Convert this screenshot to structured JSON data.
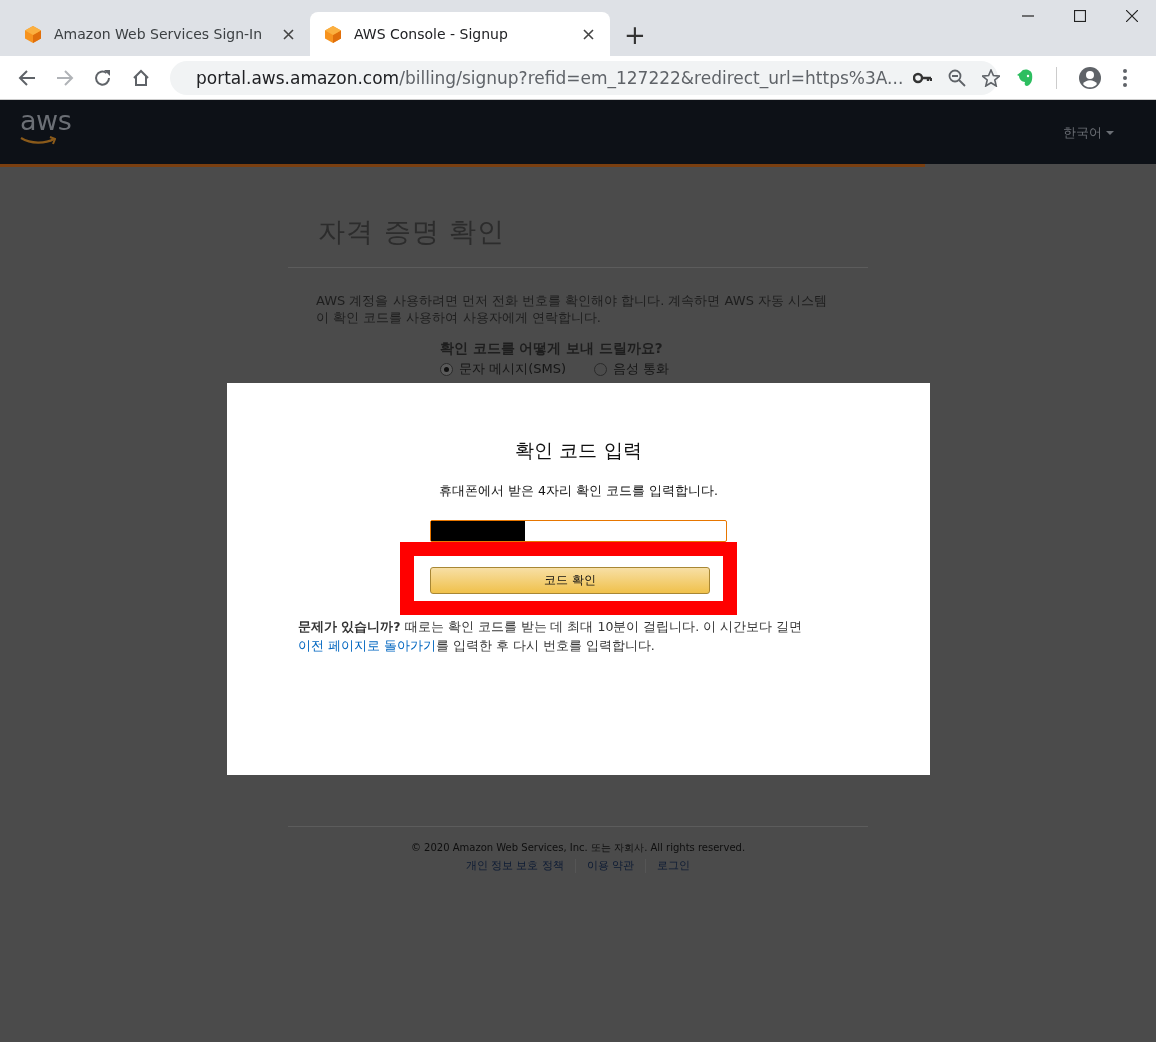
{
  "browser": {
    "tabs": [
      {
        "title": "Amazon Web Services Sign-In",
        "selected": false
      },
      {
        "title": "AWS Console - Signup",
        "selected": true
      }
    ],
    "new_tab": "+",
    "address": {
      "host": "portal.aws.amazon.com",
      "path": "/billing/signup?refid=em_127222&redirect_url=https%3A..."
    }
  },
  "header": {
    "logo": "aws",
    "language": "한국어"
  },
  "page": {
    "title": "자격 증명 확인",
    "intro": "AWS 계정을 사용하려면 먼저 전화 번호를 확인해야 합니다. 계속하면 AWS 자동 시스템이 확인 코드를 사용하여 사용자에게 연락합니다.",
    "question": "확인 코드를 어떻게 보내 드릴까요?",
    "options": [
      {
        "label": "문자 메시지(SMS)",
        "selected": true
      },
      {
        "label": "음성 통화",
        "selected": false
      }
    ],
    "footer": {
      "copyright": "© 2020 Amazon Web Services, Inc. 또는 자회사. All rights reserved.",
      "links": [
        "개인 정보 보호 정책",
        "이용 약관",
        "로그인"
      ]
    }
  },
  "modal": {
    "title": "확인 코드 입력",
    "instruction": "휴대폰에서 받은 4자리 확인 코드를 입력합니다.",
    "code_redacted": true,
    "button": "코드 확인",
    "highlighted": true,
    "help": {
      "text": "**문제가 있습니까?** 때로는 확인 코드를 받는 데 최대 10분이 걸립니다. 이 시간보다 길면 ",
      "link": "이전 페이지로 돌아가기",
      "after": "를 입력한 후 다시 번호를 입력합니다."
    }
  }
}
